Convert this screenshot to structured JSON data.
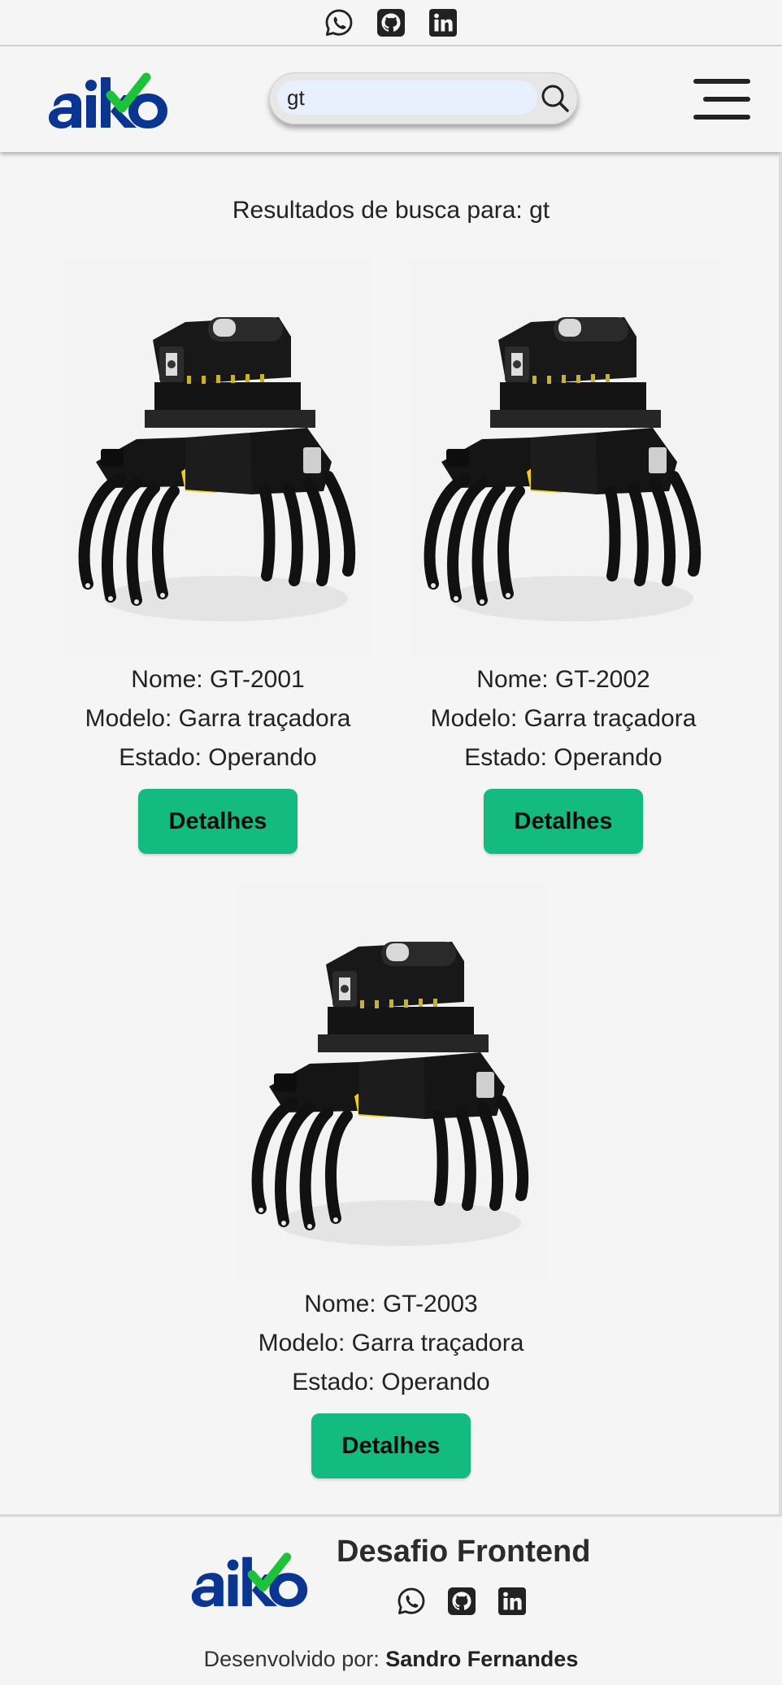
{
  "topbar": {
    "icons": [
      "whatsapp-icon",
      "github-icon",
      "linkedin-icon"
    ]
  },
  "header": {
    "logo_text": "aiko",
    "search": {
      "value": "gt",
      "icon": "search-icon"
    },
    "menu_icon": "hamburger-menu-icon"
  },
  "results": {
    "title": "Resultados de busca para: gt"
  },
  "cards": [
    {
      "nome": "Nome: GT-2001",
      "modelo": "Modelo: Garra traçadora",
      "estado": "Estado: Operando",
      "button": "Detalhes"
    },
    {
      "nome": "Nome: GT-2002",
      "modelo": "Modelo: Garra traçadora",
      "estado": "Estado: Operando",
      "button": "Detalhes"
    },
    {
      "nome": "Nome: GT-2003",
      "modelo": "Modelo: Garra traçadora",
      "estado": "Estado: Operando",
      "button": "Detalhes"
    }
  ],
  "footer": {
    "logo_text": "aiko",
    "title": "Desafio Frontend",
    "icons": [
      "whatsapp-icon",
      "github-icon",
      "linkedin-icon"
    ],
    "credit_prefix": "Desenvolvido por:",
    "credit_name": "Sandro Fernandes"
  },
  "colors": {
    "brand_blue": "#0a3590",
    "brand_green": "#1ec23a",
    "button_green": "#13bb80",
    "machine_yellow": "#f2cc1a"
  }
}
